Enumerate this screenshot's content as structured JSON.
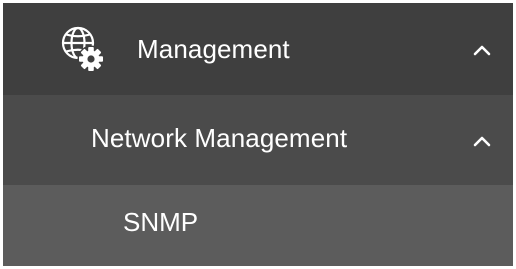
{
  "menu": {
    "level1": {
      "label": "Management",
      "icon": "globe-gear-icon",
      "expanded": true,
      "toggle_icon": "chevron-up-icon"
    },
    "level2": {
      "label": "Network Management",
      "expanded": true,
      "toggle_icon": "chevron-up-icon"
    },
    "level3": {
      "label": "SNMP"
    }
  },
  "colors": {
    "level1_bg": "#3f3f3f",
    "level2_bg": "#4b4b4b",
    "level3_bg": "#5c5c5c",
    "text": "#ffffff"
  }
}
